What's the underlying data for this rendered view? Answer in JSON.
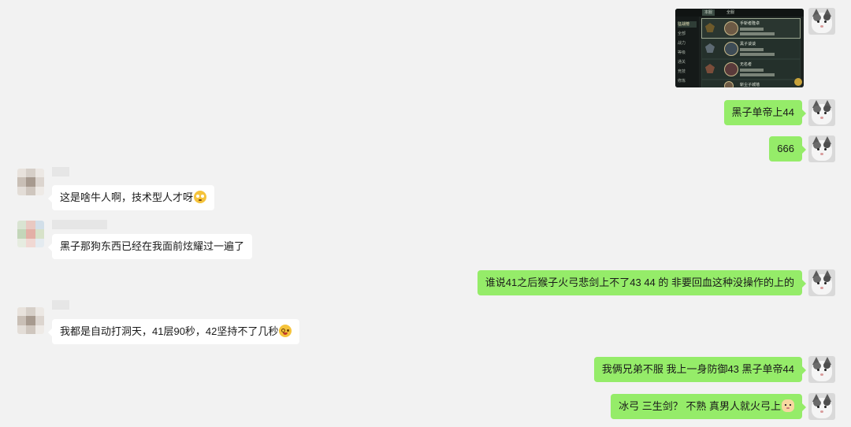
{
  "colors": {
    "background": "#f2f2f2",
    "my_bubble": "#95ec69",
    "their_bubble": "#ffffff"
  },
  "screenshot_image": {
    "tabs": [
      "本服",
      "全服"
    ],
    "sidebar": [
      "征战榜",
      "全部",
      "战力",
      "等级",
      "通关",
      "竞技",
      "修炼"
    ],
    "rows": [
      {
        "name": "手斩者隆卓"
      },
      {
        "name": "黑子谈谈"
      },
      {
        "name": "无名者"
      },
      {
        "name": "斩尘子城墙"
      }
    ]
  },
  "messages": [
    {
      "id": "m1",
      "side": "mine",
      "type": "image",
      "text": ""
    },
    {
      "id": "m2",
      "side": "mine",
      "type": "text",
      "text": "黑子单帝上44"
    },
    {
      "id": "m3",
      "side": "mine",
      "type": "text",
      "text": "666"
    },
    {
      "id": "m4",
      "side": "theirs",
      "type": "text",
      "text": "这是啥牛人啊，技术型人才呀",
      "emoji": "flushed-face-emoji"
    },
    {
      "id": "m5",
      "side": "theirs",
      "type": "text",
      "text": "黑子那狗东西已经在我面前炫耀过一遍了"
    },
    {
      "id": "m6",
      "side": "mine",
      "type": "text",
      "text": "谁说41之后猴子火弓悲剑上不了43  44 的  非要回血这种没操作的上的"
    },
    {
      "id": "m7",
      "side": "theirs",
      "type": "text",
      "text": "我都是自动打洞天，41层90秒，42坚持不了几秒",
      "emoji": "dizzy-face-emoji"
    },
    {
      "id": "m8",
      "side": "mine",
      "type": "text",
      "text": "我俩兄弟不服 我上一身防御43   黑子单帝44"
    },
    {
      "id": "m9",
      "side": "mine",
      "type": "text",
      "text": "冰弓  三生剑？  不熟  真男人就火弓上",
      "emoji": "cat-face-emoji"
    }
  ]
}
